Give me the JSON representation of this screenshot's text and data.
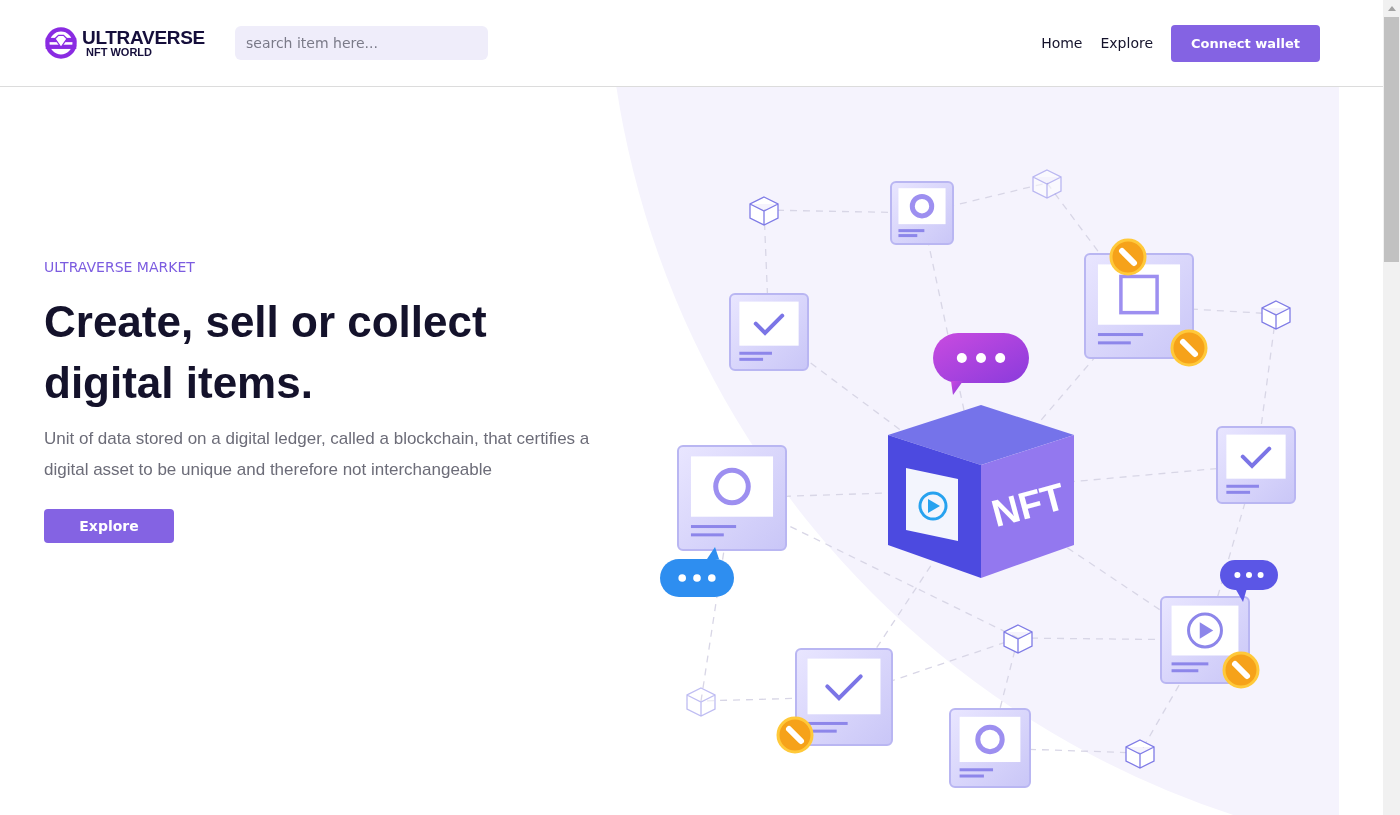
{
  "header": {
    "logo": {
      "title": "ULTRAVERSE",
      "subtitle": "NFT WORLD"
    },
    "search": {
      "placeholder": "search item here..."
    },
    "nav": [
      "Home",
      "Explore"
    ],
    "cta": "Connect wallet"
  },
  "hero": {
    "eyebrow": "ULTRAVERSE MARKET",
    "heading": "Create, sell or collect digital items.",
    "text": "Unit of data stored on a digital ledger, called a blockchain, that certifies a digital asset to be unique and therefore not interchangeable",
    "button": "Explore",
    "illustration": {
      "cube_label": "NFT"
    }
  }
}
